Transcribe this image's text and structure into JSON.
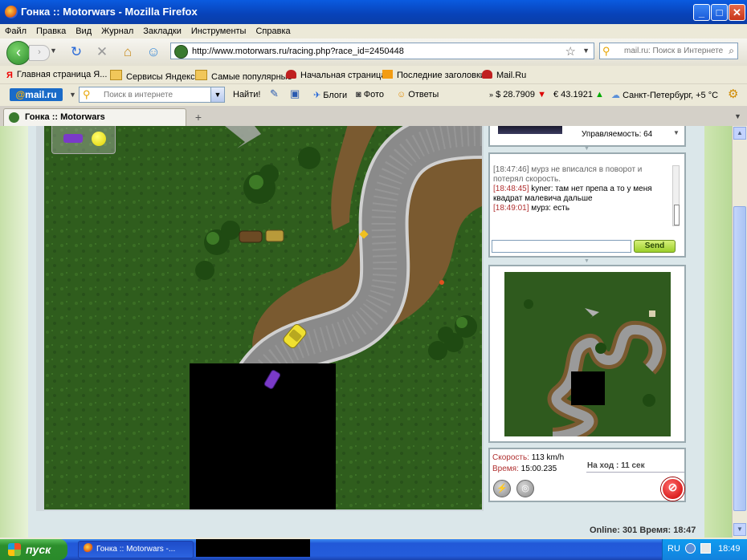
{
  "window": {
    "title": "Гонка :: Motorwars - Mozilla Firefox",
    "minimize": "_",
    "maximize": "□",
    "close": "✕"
  },
  "menu": [
    "Файл",
    "Правка",
    "Вид",
    "Журнал",
    "Закладки",
    "Инструменты",
    "Справка"
  ],
  "nav": {
    "url": "http://www.motorwars.ru/racing.php?race_id=2450448",
    "search_placeholder": "mail.ru: Поиск в Интернете"
  },
  "bookmarks": [
    {
      "label": "Главная страница Я...",
      "icon": "yandex-icon"
    },
    {
      "label": "Сервисы Яндекса",
      "icon": "folder-icon"
    },
    {
      "label": "Самые популярные",
      "icon": "folder-icon"
    },
    {
      "label": "Начальная страница",
      "icon": "motorwars-icon"
    },
    {
      "label": "Последние заголовки",
      "icon": "rss-icon"
    },
    {
      "label": "Mail.Ru",
      "icon": "motorwars-icon"
    }
  ],
  "mailbar": {
    "logo_at": "@",
    "logo_text": "mail.ru",
    "search_placeholder": "Поиск в интернете",
    "find_label": "Найти!",
    "blogs_label": "Блоги",
    "photo_label": "Фото",
    "answers_label": "Ответы",
    "usd": "$ 28.7909",
    "eur": "€ 43.1921",
    "weather": "Санкт-Петербург, +5 °C"
  },
  "tab": {
    "title": "Гонка :: Motorwars",
    "new_tab": "+"
  },
  "car_info": {
    "handling": "Управляемость: 64"
  },
  "chat": {
    "messages": [
      {
        "time": "[18:47:46]",
        "text": "мурз не вписался в поворот и потерял скорость.",
        "system": true
      },
      {
        "time": "[18:48:45]",
        "text": "kyner: там нет препа  а то у меня квадрат малевича дальше",
        "system": false
      },
      {
        "time": "[18:49:01]",
        "text": "мурз: есть",
        "system": false
      }
    ],
    "send_label": "Send"
  },
  "race_status": {
    "speed_label": "Скорость:",
    "speed_value": "113 km/h",
    "time_label": "Время:",
    "time_value": "15:00.235",
    "turn_label": "На ход :",
    "turn_value": "11 сек"
  },
  "footer": {
    "online": "Online: 301  Время: 18:47"
  },
  "taskbar": {
    "start": "пуск",
    "task": "Гонка :: Motorwars -...",
    "lang": "RU",
    "clock": "18:49"
  },
  "colors": {
    "titlebar": "#0842b8",
    "accent_red": "#b03030",
    "grass": "#2d5a1c",
    "road": "#8c8c8c"
  }
}
